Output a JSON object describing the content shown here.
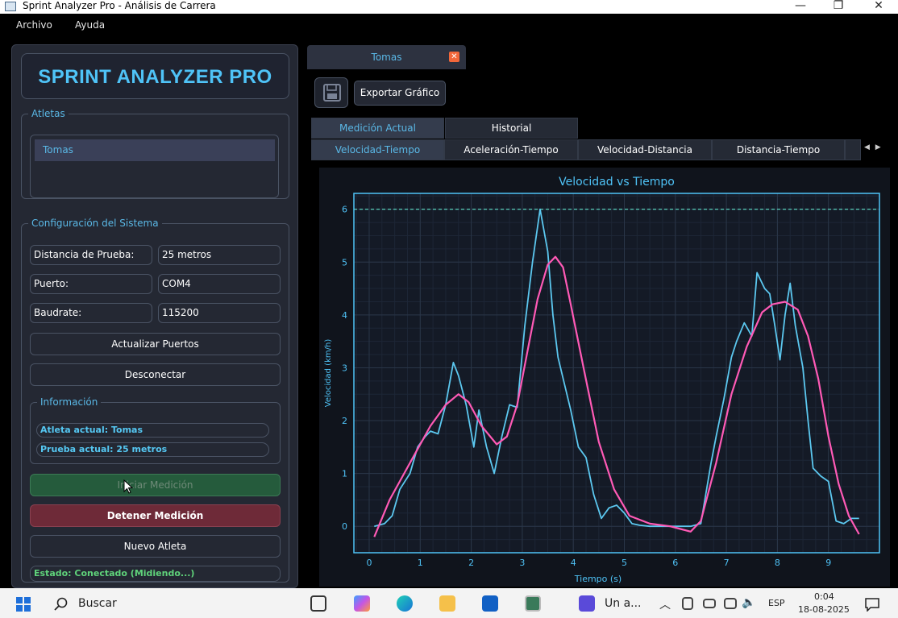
{
  "window": {
    "title": "Sprint Analyzer Pro - Análisis de Carrera",
    "minimize": "—",
    "maximize": "❐",
    "close": "✕"
  },
  "menu": {
    "file": "Archivo",
    "help": "Ayuda"
  },
  "app": {
    "name": "SPRINT ANALYZER PRO"
  },
  "athletes": {
    "label": "Atletas",
    "items": [
      "Tomas"
    ]
  },
  "config": {
    "label": "Configuración del Sistema",
    "distance_label": "Distancia de Prueba:",
    "distance_value": "25 metros",
    "port_label": "Puerto:",
    "port_value": "COM4",
    "baud_label": "Baudrate:",
    "baud_value": "115200",
    "refresh_ports": "Actualizar Puertos",
    "disconnect": "Desconectar"
  },
  "info": {
    "label": "Información",
    "current_athlete": "Atleta actual: Tomas",
    "current_test": "Prueba actual: 25 metros"
  },
  "actions": {
    "start": "Iniciar Medición",
    "stop": "Detener Medición",
    "new_athlete": "Nuevo Atleta"
  },
  "status": "Estado: Conectado (Midiendo...)",
  "doc_tab": {
    "label": "Tomas",
    "close": "✕"
  },
  "toolbar": {
    "export": "Exportar Gráfico"
  },
  "tabs_top": [
    "Medición Actual",
    "Historial"
  ],
  "tabs_charts": [
    "Velocidad-Tiempo",
    "Aceleración-Tiempo",
    "Velocidad-Distancia",
    "Distancia-Tiempo"
  ],
  "colors": {
    "accent": "#4fc3f7",
    "raw": "#5cc8f0",
    "smooth": "#ff5ab6",
    "panel": "#242833",
    "status_green": "#5fd27a"
  },
  "chart_data": {
    "type": "line",
    "title": "Velocidad vs Tiempo",
    "xlabel": "Tiempo (s)",
    "ylabel": "Velocidad (km/h)",
    "xlim": [
      -0.3,
      10.0
    ],
    "ylim": [
      -0.5,
      6.3
    ],
    "xticks": [
      0,
      1,
      2,
      3,
      4,
      5,
      6,
      7,
      8,
      9
    ],
    "yticks": [
      0,
      1,
      2,
      3,
      4,
      5,
      6
    ],
    "reference_line": 6,
    "series": [
      {
        "x": [
          0.1,
          0.3,
          0.45,
          0.6,
          0.8,
          0.95,
          1.1,
          1.2,
          1.35,
          1.5,
          1.65,
          1.75,
          1.9,
          2.05,
          2.15,
          2.3,
          2.45,
          2.6,
          2.75,
          2.9,
          3.05,
          3.2,
          3.35,
          3.5,
          3.6,
          3.7,
          3.8,
          3.95,
          4.1,
          4.25,
          4.4,
          4.55,
          4.7,
          4.85,
          5.0,
          5.15,
          5.3,
          5.5,
          5.7,
          5.9,
          6.1,
          6.3,
          6.5,
          6.7,
          6.8,
          6.95,
          7.1,
          7.2,
          7.35,
          7.5,
          7.6,
          7.75,
          7.85,
          7.95,
          8.05,
          8.15,
          8.25,
          8.35,
          8.5,
          8.6,
          8.7,
          8.85,
          9.0,
          9.15,
          9.3,
          9.45,
          9.6
        ],
        "y": [
          0.0,
          0.05,
          0.2,
          0.7,
          1.0,
          1.5,
          1.7,
          1.8,
          1.75,
          2.3,
          3.1,
          2.85,
          2.3,
          1.5,
          2.2,
          1.5,
          1.0,
          1.7,
          2.3,
          2.25,
          3.8,
          5.0,
          6.0,
          5.2,
          4.0,
          3.2,
          2.8,
          2.2,
          1.5,
          1.3,
          0.6,
          0.15,
          0.35,
          0.4,
          0.25,
          0.05,
          0.02,
          0.0,
          0.0,
          0.0,
          0.0,
          0.0,
          0.05,
          1.2,
          1.7,
          2.4,
          3.2,
          3.5,
          3.85,
          3.6,
          4.8,
          4.5,
          4.4,
          3.8,
          3.15,
          4.0,
          4.6,
          3.8,
          3.0,
          2.0,
          1.1,
          0.95,
          0.85,
          0.1,
          0.05,
          0.15,
          0.15
        ]
      },
      {
        "x": [
          0.1,
          0.4,
          0.8,
          1.2,
          1.5,
          1.75,
          1.95,
          2.2,
          2.5,
          2.7,
          2.9,
          3.1,
          3.3,
          3.5,
          3.65,
          3.8,
          3.95,
          4.2,
          4.5,
          4.8,
          5.1,
          5.5,
          5.9,
          6.1,
          6.3,
          6.5,
          6.8,
          7.1,
          7.4,
          7.7,
          7.9,
          8.15,
          8.4,
          8.6,
          8.8,
          9.0,
          9.2,
          9.4,
          9.6
        ],
        "y": [
          -0.2,
          0.5,
          1.2,
          1.9,
          2.3,
          2.5,
          2.35,
          1.9,
          1.55,
          1.7,
          2.3,
          3.3,
          4.3,
          4.95,
          5.1,
          4.9,
          4.2,
          3.0,
          1.6,
          0.7,
          0.2,
          0.05,
          0.0,
          -0.05,
          -0.1,
          0.1,
          1.2,
          2.5,
          3.4,
          4.05,
          4.2,
          4.25,
          4.1,
          3.6,
          2.8,
          1.7,
          0.8,
          0.2,
          -0.15
        ]
      }
    ]
  }
}
